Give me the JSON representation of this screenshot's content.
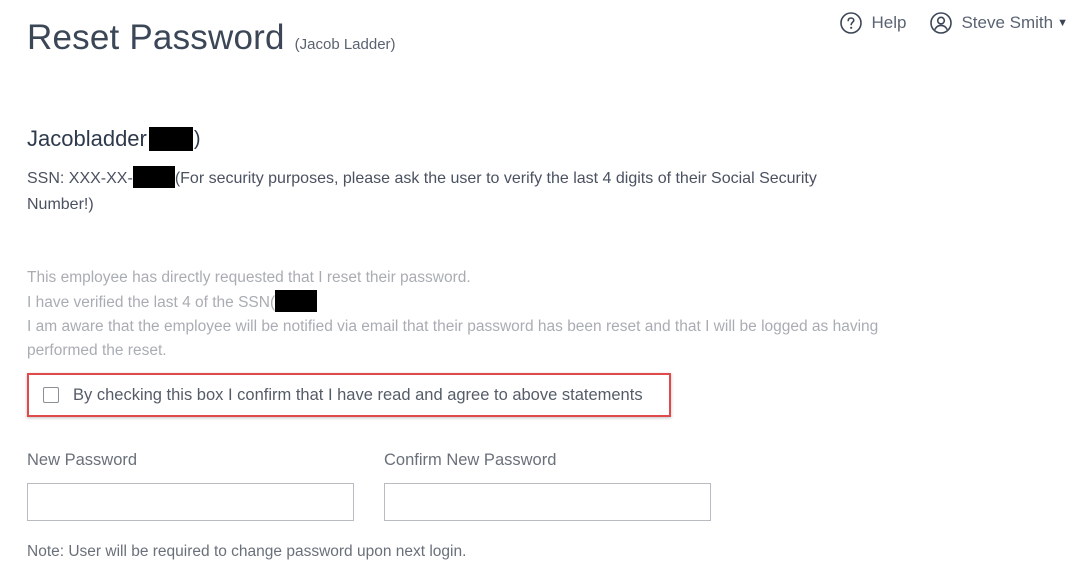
{
  "header": {
    "title": "Reset Password",
    "subtitle": "(Jacob Ladder)",
    "help_label": "Help",
    "user_name": "Steve Smith"
  },
  "employee": {
    "name": "Jacobladder",
    "name_suffix": ")",
    "ssn_prefix": "SSN: XXX-XX-",
    "ssn_note": "(For security purposes, please ask the user to verify the last 4 digits of their Social Security Number!)"
  },
  "statements": {
    "line1": "This employee has directly requested that I reset their password.",
    "line2": "I have verified the last 4 of the SSN(",
    "line3": "I am aware that the employee will be notified via email that their password has been reset and that I will be logged as having performed the reset."
  },
  "confirm": {
    "label": "By checking this box I confirm that I have read and agree to above statements",
    "checked": false
  },
  "form": {
    "new_password_label": "New Password",
    "confirm_password_label": "Confirm New Password",
    "new_password_value": "",
    "confirm_password_value": ""
  },
  "note": "Note: User will be required to change password upon next login.",
  "colors": {
    "highlight_border": "#e04a4a",
    "muted_text": "#a9adb3",
    "title_text": "#3b4656"
  }
}
